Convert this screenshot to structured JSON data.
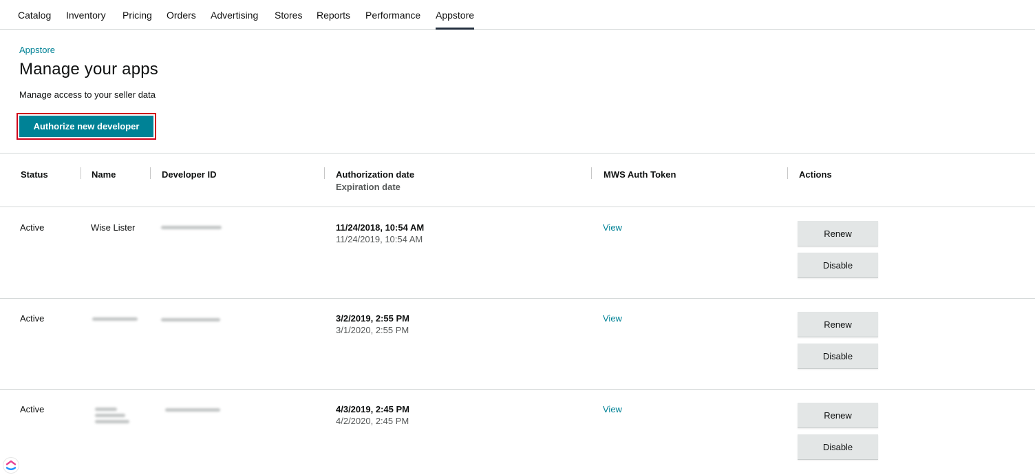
{
  "nav": {
    "items": [
      "Catalog",
      "Inventory",
      "Pricing",
      "Orders",
      "Advertising",
      "Stores",
      "Reports",
      "Performance",
      "Appstore"
    ],
    "active": "Appstore"
  },
  "breadcrumb": "Appstore",
  "page": {
    "title": "Manage your apps",
    "subtitle": "Manage access to your seller data",
    "authorize_button": "Authorize new developer"
  },
  "table": {
    "headers": {
      "status": "Status",
      "name": "Name",
      "developer_id": "Developer ID",
      "authorization_date": "Authorization date",
      "expiration_date": "Expiration date",
      "mws_auth_token": "MWS Auth Token",
      "actions": "Actions"
    },
    "rows": [
      {
        "status": "Active",
        "name": "Wise Lister",
        "authorization_date": "11/24/2018, 10:54 AM",
        "expiration_date": "11/24/2019, 10:54 AM",
        "token_link": "View",
        "renew_label": "Renew",
        "disable_label": "Disable"
      },
      {
        "status": "Active",
        "name": "",
        "authorization_date": "3/2/2019, 2:55 PM",
        "expiration_date": "3/1/2020, 2:55 PM",
        "token_link": "View",
        "renew_label": "Renew",
        "disable_label": "Disable"
      },
      {
        "status": "Active",
        "name": "",
        "authorization_date": "4/3/2019, 2:45 PM",
        "expiration_date": "4/2/2020, 2:45 PM",
        "token_link": "View",
        "renew_label": "Renew",
        "disable_label": "Disable"
      }
    ]
  },
  "colors": {
    "accent": "#008296",
    "highlight_border": "#d0021b",
    "secondary_button": "#e3e6e6"
  }
}
